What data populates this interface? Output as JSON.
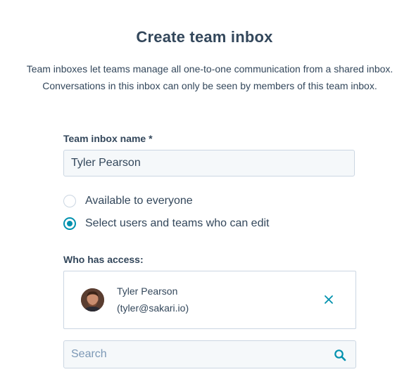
{
  "title": "Create team inbox",
  "description": "Team inboxes let teams manage all one-to-one communication from a shared inbox. Conversations in this inbox can only be seen by members of this team inbox.",
  "name_field": {
    "label": "Team inbox name *",
    "value": "Tyler Pearson"
  },
  "visibility": {
    "options": [
      {
        "label": "Available to everyone",
        "checked": false
      },
      {
        "label": "Select users and teams who can edit",
        "checked": true
      }
    ]
  },
  "access": {
    "label": "Who has access:",
    "users": [
      {
        "name": "Tyler Pearson",
        "email": "(tyler@sakari.io)"
      }
    ]
  },
  "search": {
    "placeholder": "Search"
  },
  "colors": {
    "accent": "#0091ae",
    "text": "#33475b",
    "border": "#cbd6e2",
    "input_bg": "#f5f8fa"
  },
  "icons": {
    "remove": "close-icon",
    "search": "search-icon"
  }
}
